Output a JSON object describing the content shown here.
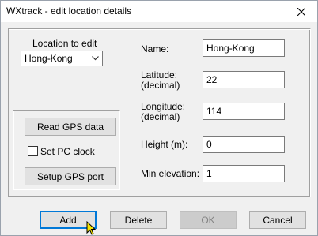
{
  "window": {
    "title": "WXtrack - edit location details"
  },
  "location": {
    "label": "Location to edit",
    "selected": "Hong-Kong"
  },
  "gps": {
    "read_label": "Read GPS data",
    "set_clock_label": "Set PC clock",
    "set_clock_checked": false,
    "setup_port_label": "Setup GPS port"
  },
  "fields": {
    "name_label": "Name:",
    "name_value": "Hong-Kong",
    "latitude_label_1": "Latitude:",
    "latitude_label_2": "(decimal)",
    "latitude_value": "22",
    "longitude_label_1": "Longitude:",
    "longitude_label_2": "(decimal)",
    "longitude_value": "114",
    "height_label": "Height (m):",
    "height_value": "0",
    "min_elevation_label": "Min elevation:",
    "min_elevation_value": "1"
  },
  "buttons": {
    "add": "Add",
    "delete": "Delete",
    "ok": "OK",
    "cancel": "Cancel"
  },
  "icons": {
    "close": "close-icon",
    "dropdown": "chevron-down-icon",
    "cursor": "mouse-pointer-icon"
  }
}
